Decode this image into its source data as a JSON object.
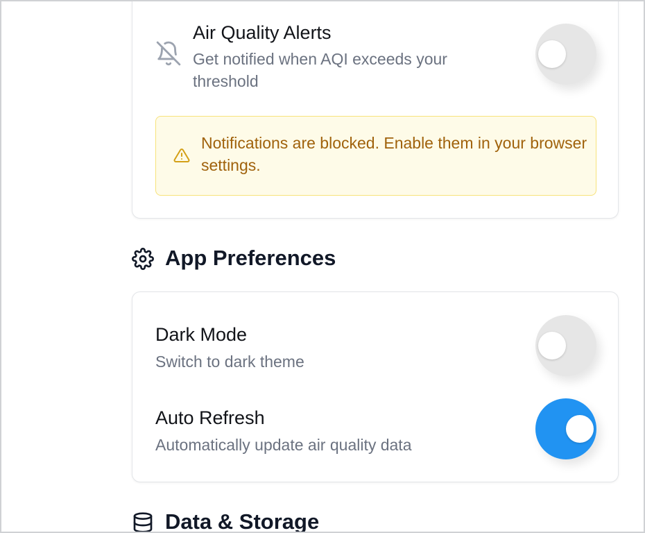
{
  "notifications": {
    "air_quality_alerts": {
      "title": "Air Quality Alerts",
      "description": "Get notified when AQI exceeds your threshold",
      "enabled": false,
      "icon": "bell-off-icon"
    },
    "warning": {
      "text": "Notifications are blocked. Enable them in your browser settings.",
      "icon": "warning-triangle-icon",
      "color": "#a0620c",
      "background": "#fefbe8"
    }
  },
  "app_preferences": {
    "heading": "App Preferences",
    "icon": "gear-icon",
    "items": [
      {
        "title": "Dark Mode",
        "description": "Switch to dark theme",
        "enabled": false
      },
      {
        "title": "Auto Refresh",
        "description": "Automatically update air quality data",
        "enabled": true
      }
    ]
  },
  "data_storage": {
    "heading": "Data & Storage",
    "icon": "database-icon"
  },
  "colors": {
    "toggle_on": "#2193f2",
    "toggle_off": "#e6e6e6"
  }
}
